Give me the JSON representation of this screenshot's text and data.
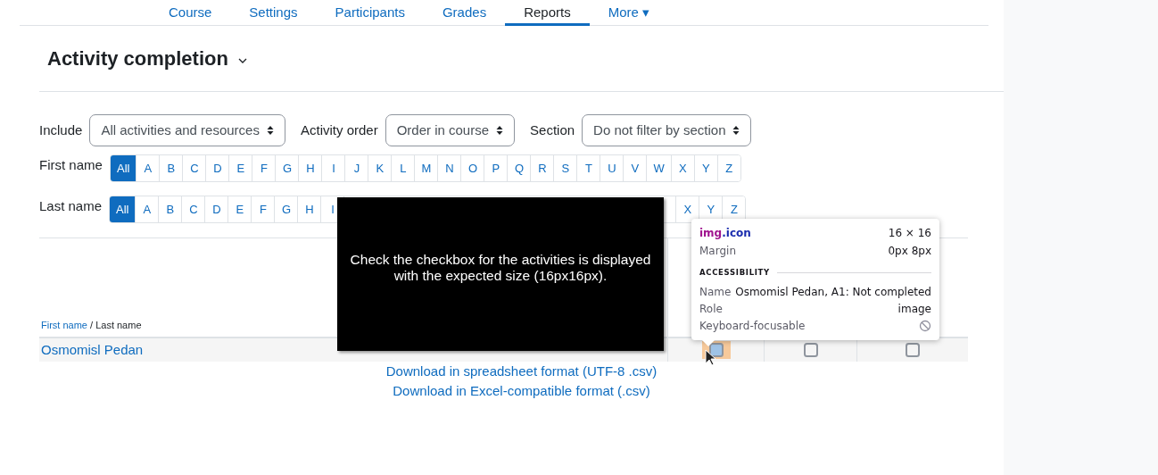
{
  "nav_tabs": [
    {
      "label": "Course",
      "selected": false
    },
    {
      "label": "Settings",
      "selected": false
    },
    {
      "label": "Participants",
      "selected": false
    },
    {
      "label": "Grades",
      "selected": false
    },
    {
      "label": "Reports",
      "selected": true
    },
    {
      "label": "More ▾",
      "selected": false
    }
  ],
  "heading": "Activity completion",
  "filters": [
    {
      "label": "Include",
      "value": "All activities and resources"
    },
    {
      "label": "Activity order",
      "value": "Order in course"
    },
    {
      "label": "Section",
      "value": "Do not filter by section"
    }
  ],
  "first_name_bar": {
    "label": "First name",
    "letters": [
      {
        "text": "All",
        "selected": true
      },
      {
        "text": "A",
        "selected": false
      },
      {
        "text": "B",
        "selected": false
      },
      {
        "text": "C",
        "selected": false
      },
      {
        "text": "D",
        "selected": false
      },
      {
        "text": "E",
        "selected": false
      },
      {
        "text": "F",
        "selected": false
      },
      {
        "text": "G",
        "selected": false
      },
      {
        "text": "H",
        "selected": false
      },
      {
        "text": "I",
        "selected": false
      },
      {
        "text": "J",
        "selected": false
      },
      {
        "text": "K",
        "selected": false
      },
      {
        "text": "L",
        "selected": false
      },
      {
        "text": "M",
        "selected": false
      },
      {
        "text": "N",
        "selected": false
      },
      {
        "text": "O",
        "selected": false
      },
      {
        "text": "P",
        "selected": false
      },
      {
        "text": "Q",
        "selected": false
      },
      {
        "text": "R",
        "selected": false
      },
      {
        "text": "S",
        "selected": false
      },
      {
        "text": "T",
        "selected": false
      },
      {
        "text": "U",
        "selected": false
      },
      {
        "text": "V",
        "selected": false
      },
      {
        "text": "W",
        "selected": false
      },
      {
        "text": "X",
        "selected": false
      },
      {
        "text": "Y",
        "selected": false
      },
      {
        "text": "Z",
        "selected": false
      }
    ]
  },
  "last_name_bar": {
    "label": "Last name",
    "letters_before": [
      {
        "text": "All",
        "selected": true
      },
      {
        "text": "A",
        "selected": false
      },
      {
        "text": "B",
        "selected": false
      },
      {
        "text": "C",
        "selected": false
      },
      {
        "text": "D",
        "selected": false
      },
      {
        "text": "E",
        "selected": false
      },
      {
        "text": "F",
        "selected": false
      },
      {
        "text": "G",
        "selected": false
      },
      {
        "text": "H",
        "selected": false
      },
      {
        "text": "I",
        "selected": false
      }
    ],
    "letters_after": [
      {
        "text": "X",
        "selected": false
      },
      {
        "text": "Y",
        "selected": false
      },
      {
        "text": "Z",
        "selected": false
      }
    ]
  },
  "table": {
    "sort_header": {
      "first": "First name",
      "separator": " / ",
      "last": "Last name"
    },
    "rows": [
      {
        "name": "Osmomisl Pedan",
        "completions": [
          {
            "checked": false,
            "highlighted": true
          },
          {
            "checked": false,
            "highlighted": false
          },
          {
            "checked": false,
            "highlighted": false
          }
        ]
      }
    ]
  },
  "downloads": [
    "Download in spreadsheet format (UTF-8 .csv)",
    "Download in Excel-compatible format (.csv)"
  ],
  "caption_overlay": {
    "text": "Check the checkbox for the activities is displayed with the expected size (16px16px)."
  },
  "inspector_tooltip": {
    "selector_tag": "img",
    "selector_class": ".icon",
    "size": "16 × 16",
    "margin_label": "Margin",
    "margin_value": "0px 8px",
    "section": "ACCESSIBILITY",
    "props": [
      {
        "label": "Name",
        "value": "Osmomisl Pedan, A1: Not completed"
      },
      {
        "label": "Role",
        "value": "image"
      },
      {
        "label": "Keyboard-focusable"
      }
    ]
  }
}
